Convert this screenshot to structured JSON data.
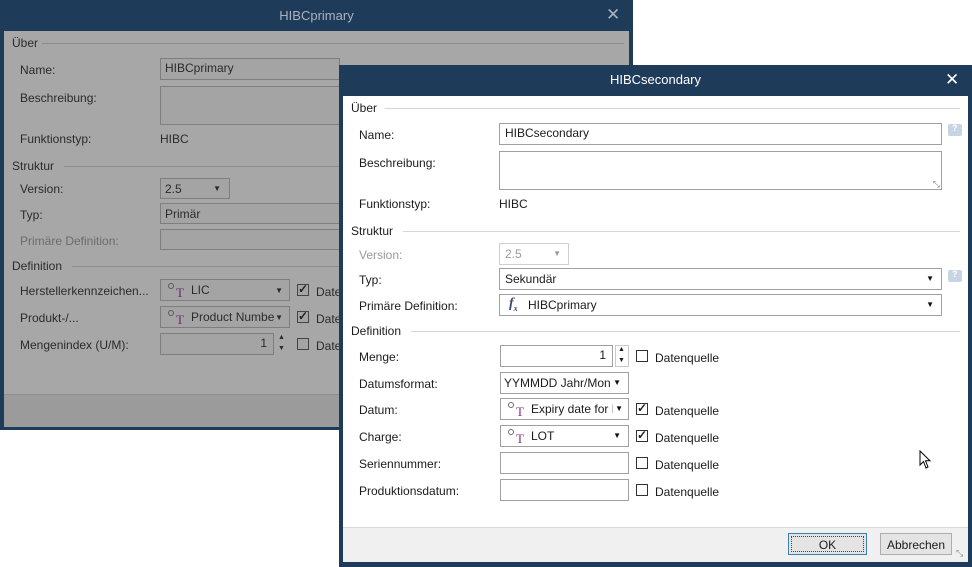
{
  "primary_dialog": {
    "title": "HIBCprimary",
    "sections": {
      "about": "Über",
      "structure": "Struktur",
      "definition": "Definition"
    },
    "fields": {
      "name_label": "Name:",
      "name_value": "HIBCprimary",
      "description_label": "Beschreibung:",
      "function_type_label": "Funktionstyp:",
      "function_type_value": "HIBC",
      "version_label": "Version:",
      "version_value": "2.5",
      "type_label": "Typ:",
      "type_value": "Primär",
      "primary_def_label": "Primäre Definition:",
      "manufacturer_label": "Herstellerkennzeichen...",
      "manufacturer_value": "LIC",
      "product_label": "Produkt-/...",
      "product_value": "Product Numbe",
      "quantity_index_label": "Mengenindex (U/M):",
      "quantity_index_value": "1",
      "datasource_label": "Date"
    }
  },
  "secondary_dialog": {
    "title": "HIBCsecondary",
    "sections": {
      "about": "Über",
      "structure": "Struktur",
      "definition": "Definition"
    },
    "fields": {
      "name_label": "Name:",
      "name_value": "HIBCsecondary",
      "description_label": "Beschreibung:",
      "function_type_label": "Funktionstyp:",
      "function_type_value": "HIBC",
      "version_label": "Version:",
      "version_value": "2.5",
      "type_label": "Typ:",
      "type_value": "Sekundär",
      "primary_def_label": "Primäre Definition:",
      "primary_def_value": "HIBCprimary",
      "quantity_label": "Menge:",
      "quantity_value": "1",
      "date_format_label": "Datumsformat:",
      "date_format_value": "YYMMDD Jahr/Mon",
      "date_label": "Datum:",
      "date_value": "Expiry date for H",
      "batch_label": "Charge:",
      "batch_value": "LOT",
      "serial_label": "Seriennummer:",
      "production_date_label": "Produktionsdatum:",
      "datasource_label": "Datenquelle"
    },
    "buttons": {
      "ok": "OK",
      "cancel": "Abbrechen"
    }
  }
}
